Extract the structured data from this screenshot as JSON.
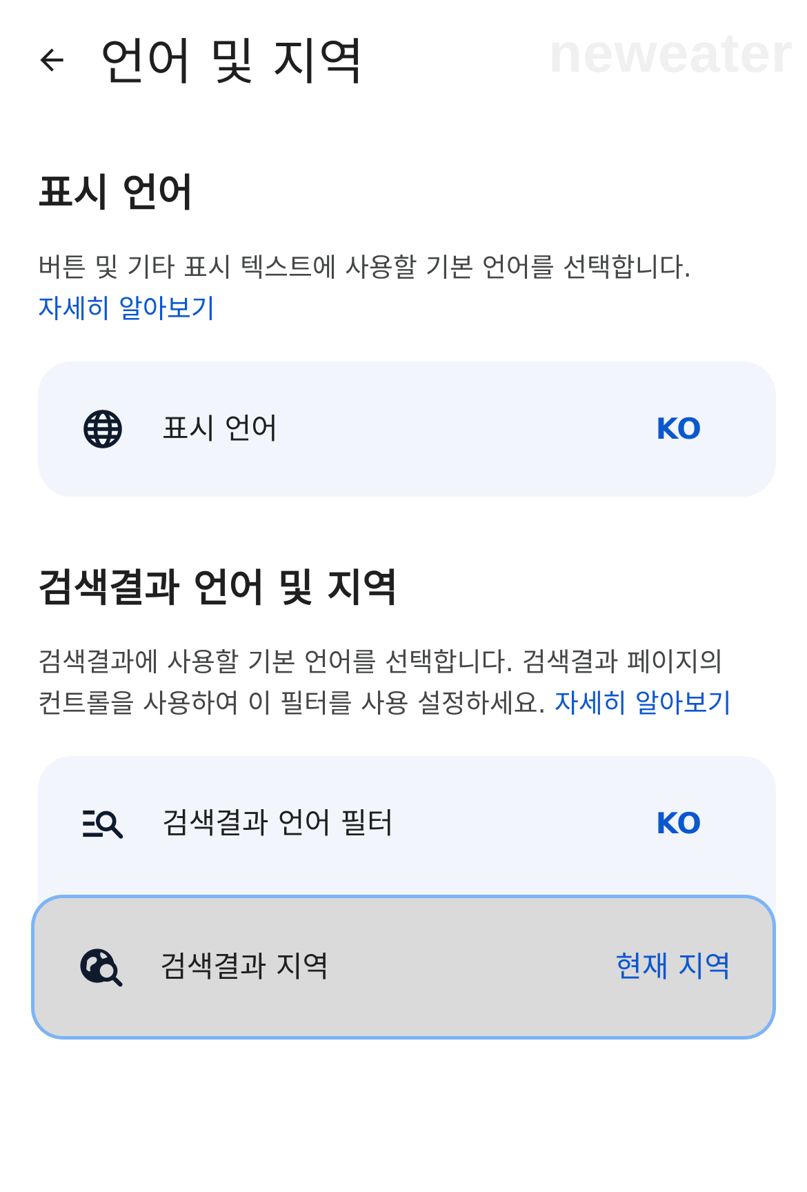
{
  "header": {
    "title": "언어 및 지역",
    "watermark": "neweater"
  },
  "display_language": {
    "heading": "표시 언어",
    "description": "버튼 및 기타 표시 텍스트에 사용할 기본 언어를 선택합니다.",
    "link": "자세히 알아보기",
    "row": {
      "label": "표시 언어",
      "value": "KO",
      "icon": "globe-icon"
    }
  },
  "search_language": {
    "heading": "검색결과 언어 및 지역",
    "description_line1": "검색결과에 사용할 기본 언어를 선택합니다. 검색결과 페이지의",
    "description_line2": "컨트롤을 사용하여 이 필터를 사용 설정하세요.",
    "link": "자세히 알아보기",
    "rows": [
      {
        "label": "검색결과 언어 필터",
        "value": "KO",
        "icon": "filter-search-icon"
      },
      {
        "label": "검색결과 지역",
        "value": "현재 지역",
        "icon": "globe-search-icon"
      }
    ]
  },
  "colors": {
    "accent": "#0b57d0",
    "card_bg": "#f2f6fc",
    "selected_bg": "#dadada",
    "selected_border": "#7cb4f5",
    "text": "#1f1f1f",
    "secondary_text": "#444746",
    "icon": "#0f1b2d"
  }
}
